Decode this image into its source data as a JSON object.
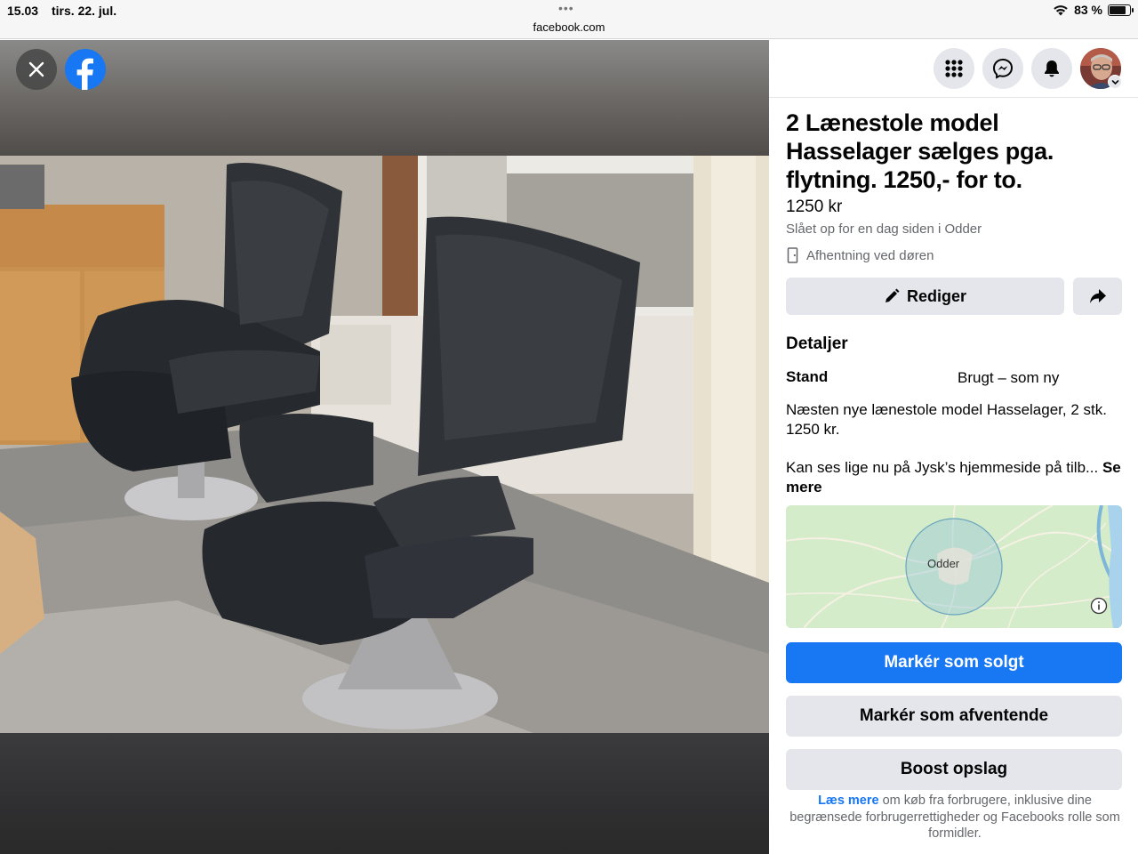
{
  "status_bar": {
    "time": "15.03",
    "date": "tirs. 22. jul.",
    "dots": "•••",
    "url": "facebook.com",
    "battery_percent_label": "83 %",
    "battery_level": 0.83
  },
  "viewer": {
    "close_icon": "close-icon",
    "logo_icon": "facebook-logo-icon",
    "photo_subject": "two-black-leather-recliner-chairs"
  },
  "header": {
    "icons": [
      "menu-grid-icon",
      "messenger-icon",
      "bell-icon",
      "avatar",
      "chevron-down-icon"
    ]
  },
  "listing": {
    "title": "2 Lænestole model Hasselager sælges pga. flytning. 1250,- for to.",
    "price": "1250 kr",
    "posted": "Slået op for en dag siden i Odder",
    "pickup": "Afhentning ved døren",
    "edit_label": "Rediger",
    "details_heading": "Detaljer",
    "condition_label": "Stand",
    "condition_value": "Brugt – som ny",
    "description_1": "Næsten nye lænestole model Hasselager, 2 stk. 1250 kr.",
    "description_2": "Kan ses lige nu på Jysk’s hjemmeside på tilb...",
    "see_more": "Se mere",
    "map_label": "Odder",
    "mark_sold": "Markér som solgt",
    "mark_pending": "Markér som afventende",
    "boost": "Boost opslag",
    "footer_link": "Læs mere",
    "footer_text": " om køb fra forbrugere, inklusive dine begrænsede forbrugerrettigheder og Facebooks rolle som formidler."
  },
  "colors": {
    "accent": "#1877f2",
    "grey_button": "#e4e6eb",
    "secondary_text": "#65676b"
  }
}
